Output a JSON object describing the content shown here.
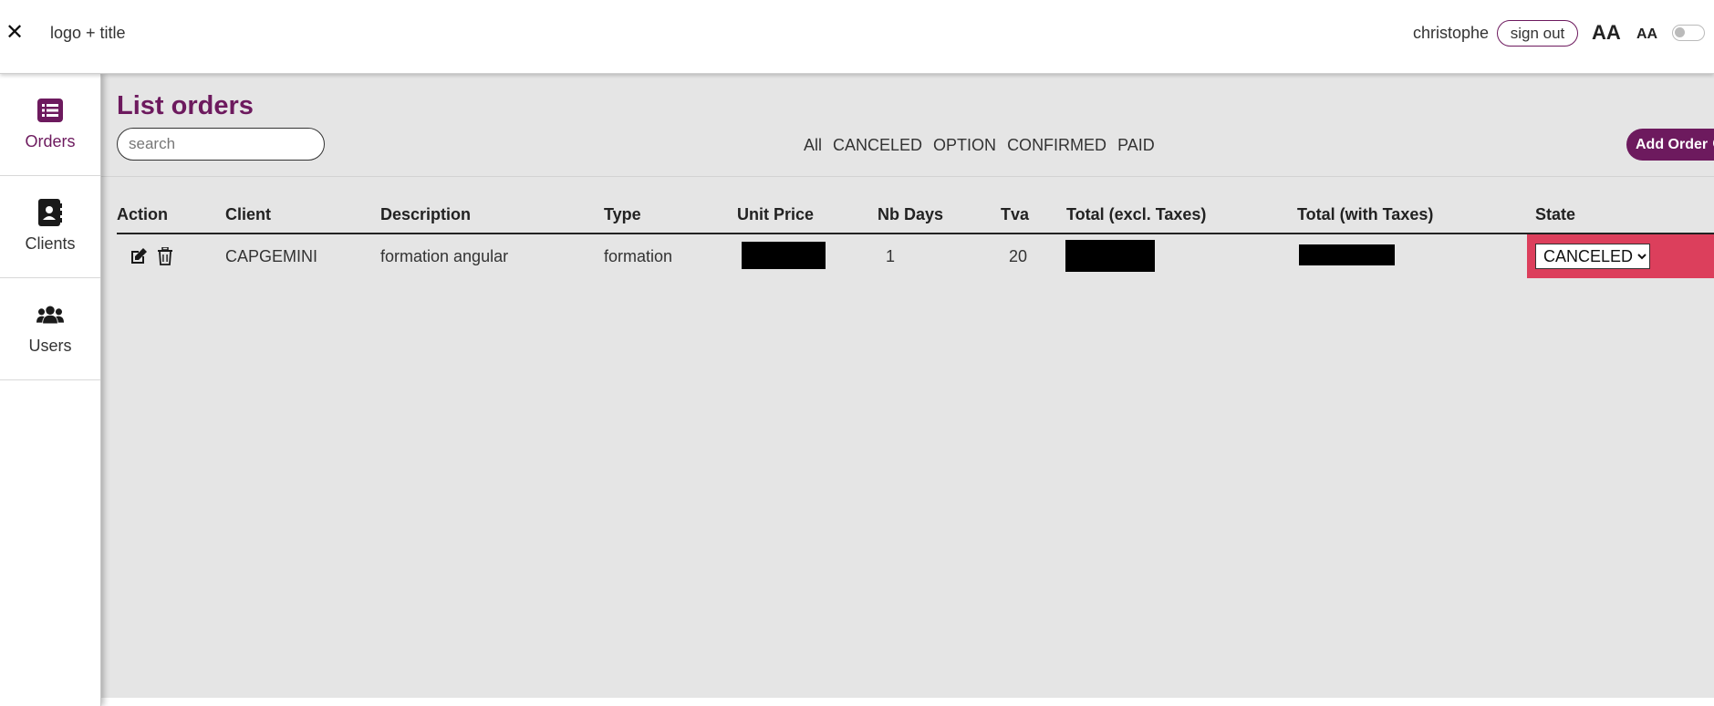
{
  "header": {
    "close_icon": "close-icon",
    "title": "logo + title",
    "username": "christophe",
    "signout_label": "sign out",
    "font_large_label": "AA",
    "font_small_label": "AA",
    "toggle_state": "off"
  },
  "sidebar": {
    "items": [
      {
        "label": "Orders",
        "icon": "list-icon",
        "active": true
      },
      {
        "label": "Clients",
        "icon": "contact-book-icon",
        "active": false
      },
      {
        "label": "Users",
        "icon": "users-icon",
        "active": false
      }
    ]
  },
  "main": {
    "title": "List orders",
    "search_placeholder": "search",
    "filters": [
      "All",
      "CANCELED",
      "OPTION",
      "CONFIRMED",
      "PAID"
    ],
    "add_order_label": "Add Order"
  },
  "table": {
    "columns": [
      "Action",
      "Client",
      "Description",
      "Type",
      "Unit Price",
      "Nb Days",
      "Tva",
      "Total (excl. Taxes)",
      "Total (with Taxes)",
      "State"
    ],
    "rows": [
      {
        "client": "CAPGEMINI",
        "description": "formation angular",
        "type": "formation",
        "unit_price": "",
        "nb_days": "1",
        "tva": "20",
        "total_excl": "",
        "total_with": "",
        "state": "CANCELED"
      }
    ],
    "state_options": [
      "CANCELED"
    ]
  },
  "colors": {
    "accent": "#6d1a5e",
    "canceled_state": "#dc3f5c",
    "main_background": "#e5e5e5"
  }
}
